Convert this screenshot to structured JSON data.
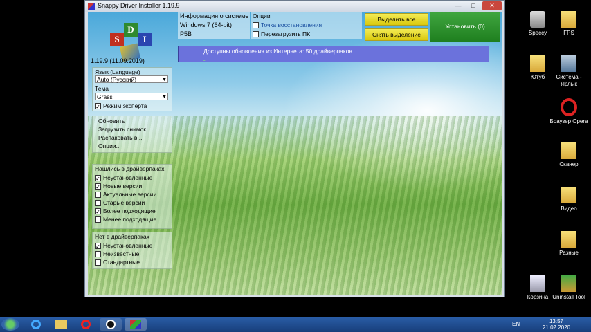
{
  "window": {
    "title": "Snappy Driver Installer 1.19.9",
    "minimize": "—",
    "maximize": "□",
    "close": "✕"
  },
  "app": {
    "logo_letters": [
      "S",
      "D",
      "I"
    ],
    "version": "1.19.9 (11.09.2019)"
  },
  "settings": {
    "language_label": "Язык (Language)",
    "language_value": "Auto (Русский)",
    "theme_label": "Тема",
    "theme_value": "Grass",
    "expert_mode_label": "Режим эксперта",
    "expert_mode_checked": true
  },
  "menu": {
    "items": [
      "Обновить",
      "Загрузить снимок...",
      "Распаковать в...",
      "Опции..."
    ]
  },
  "filters_found": {
    "title": "Нашлись в драйверпаках",
    "items": [
      {
        "label": "Неустановленные",
        "checked": true
      },
      {
        "label": "Новые версии",
        "checked": true
      },
      {
        "label": "Актуальные версии",
        "checked": false
      },
      {
        "label": "Старые версии",
        "checked": false
      },
      {
        "label": "Более подходящие",
        "checked": true
      },
      {
        "label": "Менее подходящие",
        "checked": false
      }
    ]
  },
  "filters_notfound": {
    "title": "Нет в драйверпаках",
    "items": [
      {
        "label": "Неустановленные",
        "checked": true
      },
      {
        "label": "Неизвестные",
        "checked": false
      },
      {
        "label": "Стандартные",
        "checked": false
      }
    ]
  },
  "sysinfo": {
    "title": "Информация о системе",
    "os": "Windows 7 (64-bit)",
    "machine": "P5B"
  },
  "options": {
    "title": "Опции",
    "restore_point": "Точка восстановления",
    "restore_point_checked": false,
    "reboot": "Перезагрузить ПК",
    "reboot_checked": false
  },
  "actions": {
    "select_all": "Выделить все",
    "deselect": "Снять выделение",
    "install": "Установить (0)"
  },
  "update_bar": {
    "text": "Доступны обновления из Интернета: 50 драйверпаков"
  },
  "desktop_icons": [
    {
      "label": "Speccy",
      "icon": "speccy-icon"
    },
    {
      "label": "FPS",
      "icon": "folder-icon"
    },
    {
      "label": "Ютуб",
      "icon": "folder-icon"
    },
    {
      "label": "Система - Ярлык",
      "icon": "computer-icon"
    },
    {
      "label": "Браузер Opera",
      "icon": "opera-icon"
    },
    {
      "label": "Сканер",
      "icon": "folder-icon"
    },
    {
      "label": "Видео",
      "icon": "folder-icon"
    },
    {
      "label": "Разные",
      "icon": "folder-icon"
    },
    {
      "label": "Корзина",
      "icon": "recycle-bin-icon"
    },
    {
      "label": "Uninstall Tool",
      "icon": "uninstall-tool-icon"
    }
  ],
  "taskbar": {
    "language": "EN",
    "time": "13:57",
    "date": "21.02.2020"
  },
  "colors": {
    "update_bar": "#6b72dc",
    "install_button": "#2f922f",
    "yellow_button": "#e6d829",
    "taskbar": "#1f4c91"
  }
}
